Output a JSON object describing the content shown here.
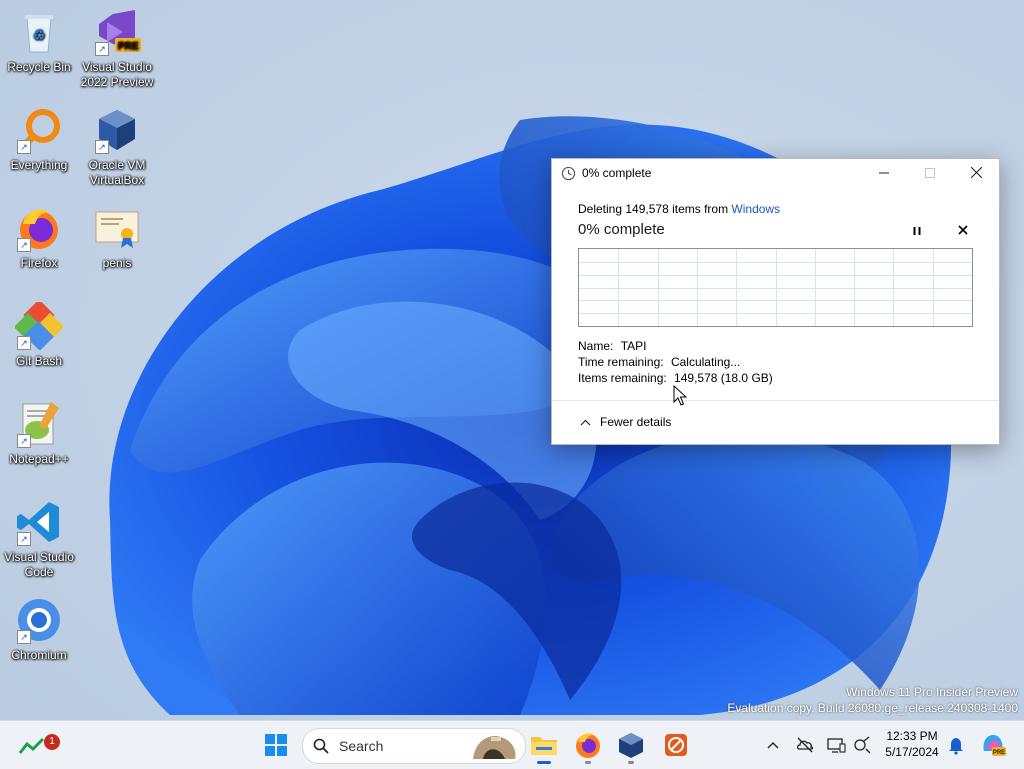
{
  "desktop": {
    "icons": [
      {
        "label": "Recycle Bin"
      },
      {
        "label": "Visual Studio 2022 Preview",
        "badge": "PRE"
      },
      {
        "label": "Everything"
      },
      {
        "label": "Oracle VM VirtualBox"
      },
      {
        "label": "Firefox"
      },
      {
        "label": "penis"
      },
      {
        "label": "Git Bash"
      },
      {
        "label": "Notepad++"
      },
      {
        "label": "Visual Studio Code"
      },
      {
        "label": "Chromium"
      }
    ],
    "watermark": {
      "line1": "Windows 11 Pro Insider Preview",
      "line2": "Evaluation copy. Build 26080.ge_release.240308-1400"
    }
  },
  "dialog": {
    "title": "0% complete",
    "deleting_prefix": "Deleting 149,578 items from ",
    "deleting_location": "Windows",
    "heading": "0% complete",
    "progress_percent": 0,
    "details": {
      "name_label": "Name:",
      "name_value": "TAPI",
      "time_label": "Time remaining:",
      "time_value": "Calculating...",
      "items_label": "Items remaining:",
      "items_value": "149,578 (18.0 GB)"
    },
    "fewer_details": "Fewer details",
    "icons": {
      "title": "clock-icon",
      "pause": "pause-icon",
      "cancel": "close-icon"
    }
  },
  "taskbar": {
    "search_placeholder": "Search",
    "notification_badge": "1",
    "clock": {
      "time": "12:33 PM",
      "date": "5/17/2024"
    },
    "accent": "#1a5fd1",
    "apps": [
      "widgets",
      "start",
      "search",
      "file-explorer",
      "firefox",
      "virtualbox",
      "app-orange"
    ],
    "tray": [
      "chevron-up-icon",
      "onedrive-offline-icon",
      "display-icon",
      "network-icon",
      "notifications-bell-icon",
      "copilot-icon"
    ]
  }
}
